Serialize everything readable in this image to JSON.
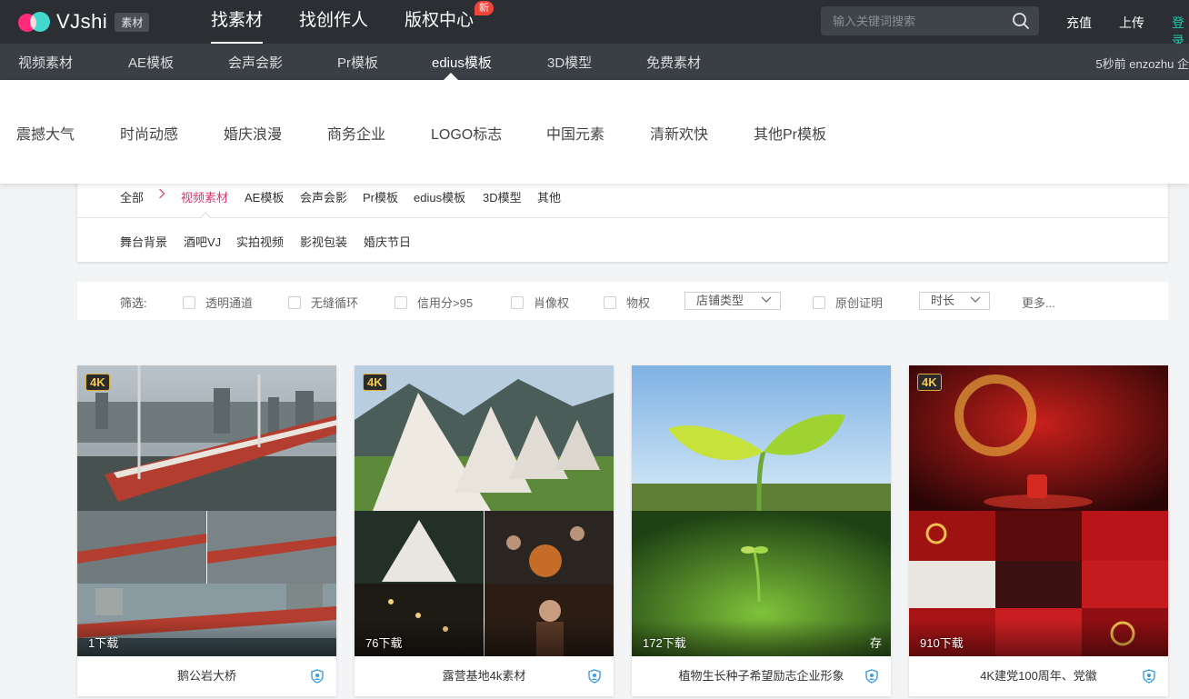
{
  "header": {
    "logo_text": "VJshi",
    "logo_badge": "素材",
    "nav": [
      "找素材",
      "找创作人",
      "版权中心"
    ],
    "new_badge": "新",
    "search_placeholder": "输入关键词搜索",
    "recharge": "充值",
    "upload": "上传",
    "login": "登录"
  },
  "subnav": {
    "items": [
      "视频素材",
      "AE模板",
      "会声会影",
      "Pr模板",
      "edius模板",
      "3D模型",
      "免费素材"
    ],
    "status": "5秒前 enzozhu 企"
  },
  "dropdown": {
    "items": [
      "震撼大气",
      "时尚动感",
      "婚庆浪漫",
      "商务企业",
      "LOGO标志",
      "中国元素",
      "清新欢快",
      "其他Pr模板"
    ]
  },
  "categories": {
    "all": "全部",
    "items": [
      "视频素材",
      "AE模板",
      "会声会影",
      "Pr模板",
      "edius模板",
      "3D模型",
      "其他"
    ],
    "sub_items": [
      "舞台背景",
      "酒吧VJ",
      "实拍视频",
      "影视包装",
      "婚庆节日"
    ]
  },
  "filters": {
    "label": "筛选:",
    "options": [
      "透明通道",
      "无缝循环",
      "信用分>95",
      "肖像权",
      "物权"
    ],
    "shop_type": "店铺类型",
    "original": "原创证明",
    "duration": "时长",
    "more": "更多..."
  },
  "cards": [
    {
      "badge": "4K",
      "downloads": "1下载",
      "title": "鹅公岩大桥"
    },
    {
      "badge": "4K",
      "downloads": "76下载",
      "title": "露营基地4k素材"
    },
    {
      "badge": "",
      "downloads": "172下载",
      "title": "植物生长种子希望励志企业形象",
      "store_tag": "存"
    },
    {
      "badge": "4K",
      "downloads": "910下载",
      "title": "4K建党100周年、党徽"
    }
  ],
  "colors": {
    "header_bg": "#2b2f33",
    "subnav_bg": "#3a3f45",
    "accent_pink": "#e0306f",
    "login_green": "#1fc8b0",
    "new_badge_red": "#f0443b",
    "badge_gold": "#f5c84c"
  }
}
